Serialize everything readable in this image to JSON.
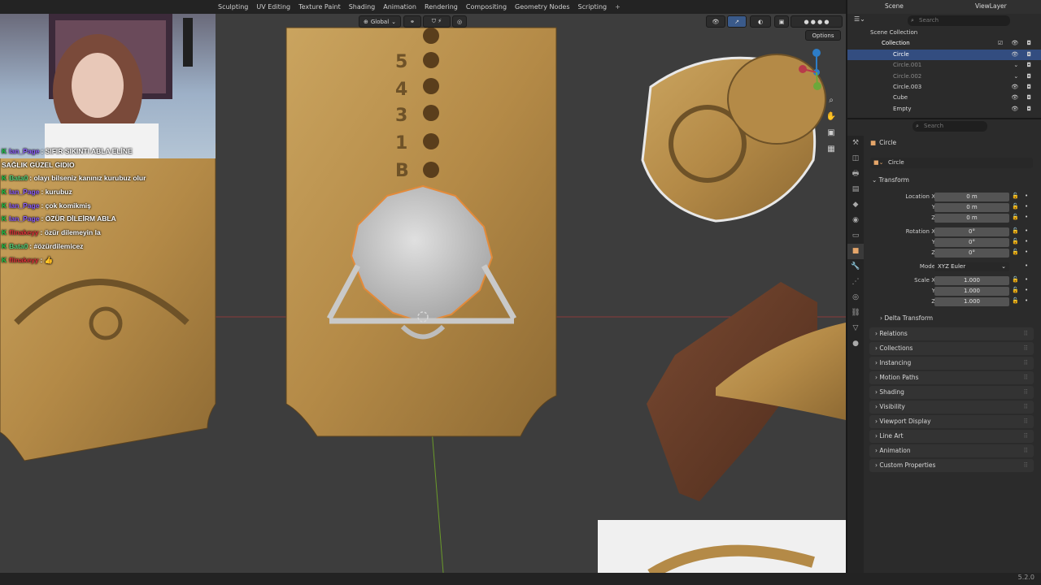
{
  "workspaces": [
    "Sculpting",
    "UV Editing",
    "Texture Paint",
    "Shading",
    "Animation",
    "Rendering",
    "Compositing",
    "Geometry Nodes",
    "Scripting",
    "+"
  ],
  "viewport": {
    "transform_orientation": "Global",
    "options_label": "Options"
  },
  "chat": [
    {
      "user": "Ian_Page",
      "message": ": SIFIR SIKINTI ABLA ELİNE"
    },
    {
      "user": "",
      "message": "SAĞLIK GÜZEL GIDIO"
    },
    {
      "user": "Bata0",
      "message": ": olayı bilseniz kanınız kurubuz olur"
    },
    {
      "user": "Ian_Page",
      "message": ": kurubuz"
    },
    {
      "user": "Ian_Page",
      "message": ": çok komikmiş"
    },
    {
      "user": "Ian_Page",
      "message": ": ÖZÜR DİLEİRM ABLA"
    },
    {
      "user": "flinakeyy",
      "message": ": özür dilemeyin la"
    },
    {
      "user": "Bata0",
      "message": ": #özürdilemicez"
    },
    {
      "user": "flinakeyy",
      "message": ": 👍"
    }
  ],
  "outliner": {
    "scene": "Scene",
    "view_layer": "ViewLayer",
    "search_placeholder": "Search",
    "rows": [
      {
        "label": "Scene Collection",
        "indent": 0
      },
      {
        "label": "Collection",
        "indent": 1
      },
      {
        "label": "Circle",
        "indent": 2,
        "selected": true
      },
      {
        "label": "Circle.001",
        "indent": 2
      },
      {
        "label": "Circle.002",
        "indent": 2
      },
      {
        "label": "Circle.003",
        "indent": 2
      },
      {
        "label": "Cube",
        "indent": 2
      },
      {
        "label": "Empty",
        "indent": 2
      }
    ]
  },
  "properties": {
    "search_placeholder": "Search",
    "object_name": "Circle",
    "object_field": "Circle",
    "transform_title": "Transform",
    "location": {
      "label_x": "Location X",
      "label_y": "Y",
      "label_z": "Z",
      "x": "0 m",
      "y": "0 m",
      "z": "0 m"
    },
    "rotation": {
      "label_x": "Rotation X",
      "label_y": "Y",
      "label_z": "Z",
      "x": "0°",
      "y": "0°",
      "z": "0°"
    },
    "mode": {
      "label": "Mode",
      "value": "XYZ Euler"
    },
    "scale": {
      "label_x": "Scale X",
      "label_y": "Y",
      "label_z": "Z",
      "x": "1.000",
      "y": "1.000",
      "z": "1.000"
    },
    "delta_transform": "Delta Transform",
    "sections": [
      "Relations",
      "Collections",
      "Instancing",
      "Motion Paths",
      "Shading",
      "Visibility",
      "Viewport Display",
      "Line Art",
      "Animation",
      "Custom Properties"
    ]
  },
  "status": {
    "version": "5.2.0"
  },
  "colors": {
    "selected_row": "#334d80",
    "accent_orange": "#e5a66a",
    "chat_badge": "#1ac54a"
  }
}
